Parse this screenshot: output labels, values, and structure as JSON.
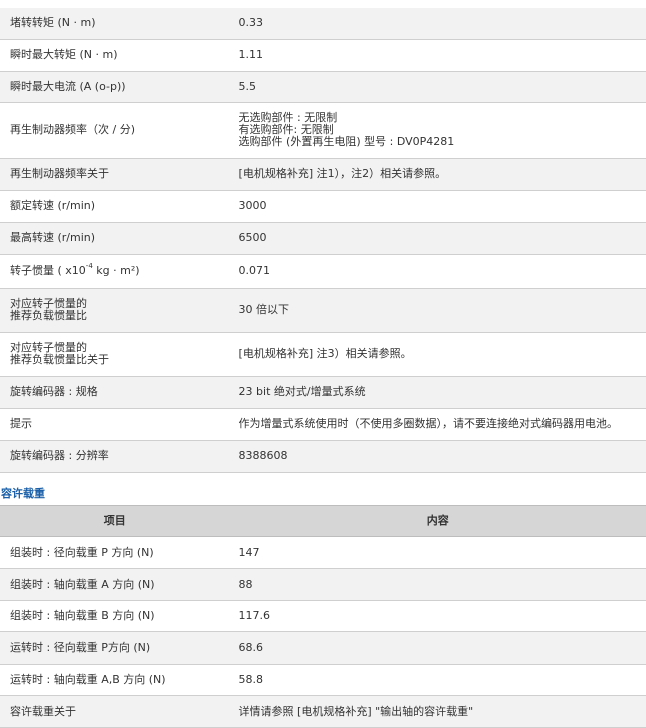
{
  "spec_rows": [
    {
      "label": "堵转转矩 (N · m)",
      "value": "0.33"
    },
    {
      "label": "瞬时最大转矩 (N · m)",
      "value": "1.11"
    },
    {
      "label": "瞬时最大电流 (A (o-p))",
      "value": "5.5"
    },
    {
      "label": "再生制动器频率（次 / 分)",
      "value_lines": [
        "无选购部件 : 无限制",
        "有选购部件: 无限制",
        "选购部件 (外置再生电阻) 型号 : DV0P4281"
      ]
    },
    {
      "label": "再生制动器频率关于",
      "value": "[电机规格补充] 注1），注2）相关请参照。"
    },
    {
      "label": "额定转速 (r/min)",
      "value": "3000"
    },
    {
      "label": "最高转速 (r/min)",
      "value": "6500"
    },
    {
      "label_pre": "转子惯量 ( x10",
      "label_sup": "-4",
      "label_post": " kg · m²)",
      "value": "0.071"
    },
    {
      "label_lines": [
        "对应转子惯量的",
        "推荐负载惯量比"
      ],
      "value": "30 倍以下"
    },
    {
      "label_lines": [
        "对应转子惯量的",
        "推荐负载惯量比关于"
      ],
      "value": "[电机规格补充] 注3）相关请参照。"
    },
    {
      "label": "旋转编码器 : 规格",
      "value": "23 bit 绝对式/增量式系统"
    },
    {
      "label": "提示",
      "value": "作为增量式系统使用时（不使用多圈数据），请不要连接绝对式编码器用电池。"
    },
    {
      "label": "旋转编码器 : 分辨率",
      "value": "8388608"
    }
  ],
  "load_section": {
    "title": "容许载重",
    "header": {
      "col1": "项目",
      "col2": "内容"
    },
    "rows": [
      {
        "label": "组装时 : 径向载重 P 方向 (N)",
        "value": "147"
      },
      {
        "label": "组装时 : 轴向载重 A 方向 (N)",
        "value": "88"
      },
      {
        "label": "组装时 : 轴向载重 B 方向 (N)",
        "value": "117.6"
      },
      {
        "label": "运转时 : 径向载重 P方向 (N)",
        "value": "68.6"
      },
      {
        "label": "运转时 : 轴向载重 A,B 方向 (N)",
        "value": "58.8"
      },
      {
        "label": "容许载重关于",
        "value": "详情请参照 [电机规格补充] \"输出轴的容许载重\""
      }
    ]
  },
  "colors": {
    "row_alt": "#f2f2f2",
    "header_bg": "#d6d6d6",
    "title": "#1a5fa8",
    "border": "#cfcfcf"
  }
}
